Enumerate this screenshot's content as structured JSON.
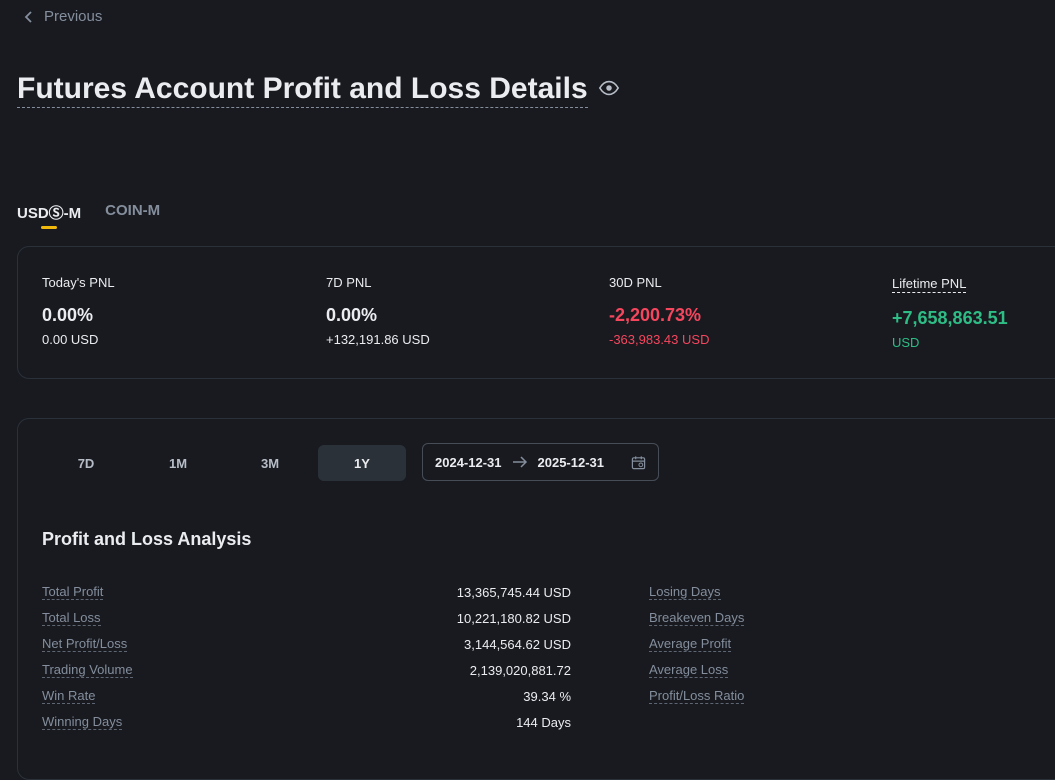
{
  "nav": {
    "back_label": "Previous"
  },
  "page": {
    "title": "Futures Account Profit and Loss Details"
  },
  "tabs": [
    {
      "label": "USDⓈ-M"
    },
    {
      "label": "COIN-M"
    }
  ],
  "pnl": {
    "today": {
      "label": "Today's PNL",
      "value": "0.00%",
      "sub": "0.00 USD"
    },
    "seven_d": {
      "label": "7D PNL",
      "value": "0.00%",
      "sub": "+132,191.86 USD"
    },
    "thirty_d": {
      "label": "30D PNL",
      "value": "-2,200.73%",
      "sub": "-363,983.43 USD"
    },
    "lifetime": {
      "label": "Lifetime PNL",
      "value": "+7,658,863.51",
      "sub": "USD"
    }
  },
  "ranges": [
    {
      "label": "7D"
    },
    {
      "label": "1M"
    },
    {
      "label": "3M"
    },
    {
      "label": "1Y"
    }
  ],
  "date_range": {
    "start": "2024-12-31",
    "end": "2025-12-31"
  },
  "analysis": {
    "title": "Profit and Loss Analysis",
    "left": [
      {
        "label": "Total Profit",
        "value": "13,365,745.44 USD"
      },
      {
        "label": "Total Loss",
        "value": "10,221,180.82 USD"
      },
      {
        "label": "Net Profit/Loss",
        "value": "3,144,564.62 USD"
      },
      {
        "label": "Trading Volume",
        "value": "2,139,020,881.72"
      },
      {
        "label": "Win Rate",
        "value": "39.34 %"
      },
      {
        "label": "Winning Days",
        "value": "144 Days"
      }
    ],
    "right": [
      {
        "label": "Losing Days"
      },
      {
        "label": "Breakeven Days"
      },
      {
        "label": "Average Profit"
      },
      {
        "label": "Average Loss"
      },
      {
        "label": "Profit/Loss Ratio"
      }
    ]
  },
  "colors": {
    "accent": "#f0b90b",
    "negative": "#f6465d",
    "positive": "#2ebd85",
    "background": "#181a20"
  }
}
